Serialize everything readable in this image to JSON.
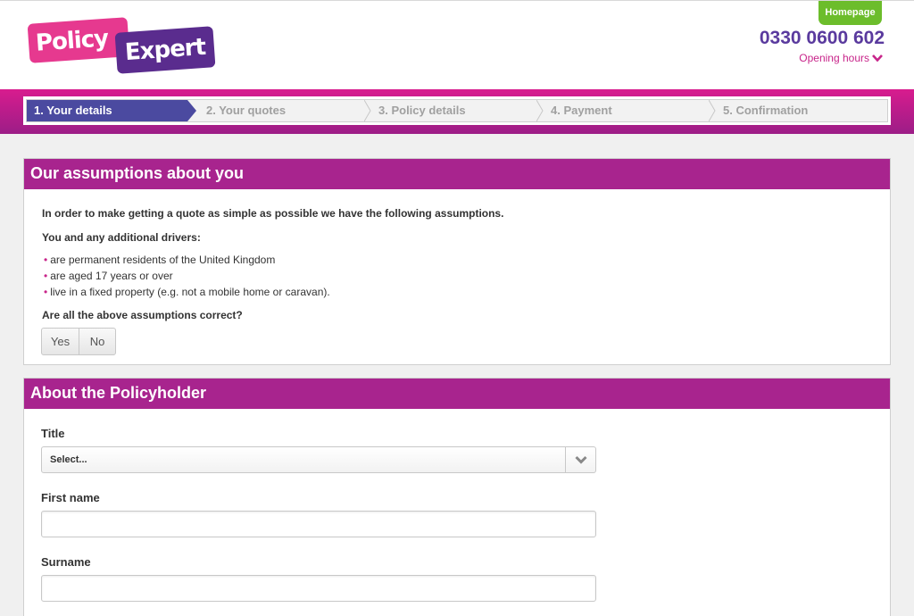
{
  "header": {
    "logo_text_1": "Policy",
    "logo_text_2": "Expert",
    "homepage_label": "Homepage",
    "phone": "0330 0600 602",
    "opening_hours_label": "Opening hours"
  },
  "steps": [
    {
      "label": "1. Your details",
      "active": true
    },
    {
      "label": "2. Your quotes",
      "active": false
    },
    {
      "label": "3. Policy details",
      "active": false
    },
    {
      "label": "4. Payment",
      "active": false
    },
    {
      "label": "5. Confirmation",
      "active": false
    }
  ],
  "assumptions": {
    "title": "Our assumptions about you",
    "intro": "In order to make getting a quote as simple as possible we have the following assumptions.",
    "subheading": "You and any additional drivers:",
    "items": [
      "are permanent residents of the United Kingdom",
      "are aged 17 years or over",
      "live in a fixed property (e.g. not a mobile home or caravan)."
    ],
    "question": "Are all the above assumptions correct?",
    "yes_label": "Yes",
    "no_label": "No"
  },
  "policyholder": {
    "title": "About the Policyholder",
    "title_label": "Title",
    "title_select_value": "Select...",
    "first_name_label": "First name",
    "first_name_value": "",
    "surname_label": "Surname",
    "surname_value": ""
  },
  "colors": {
    "brand_magenta": "#a8248e",
    "brand_purple": "#4b4aa0",
    "homepage_green": "#6cbd2b",
    "phone_purple": "#5a3a9e",
    "link_pink": "#c8258a"
  },
  "icons": {
    "opening_hours": "chevron-down-icon",
    "select_arrow": "chevron-down-icon"
  }
}
